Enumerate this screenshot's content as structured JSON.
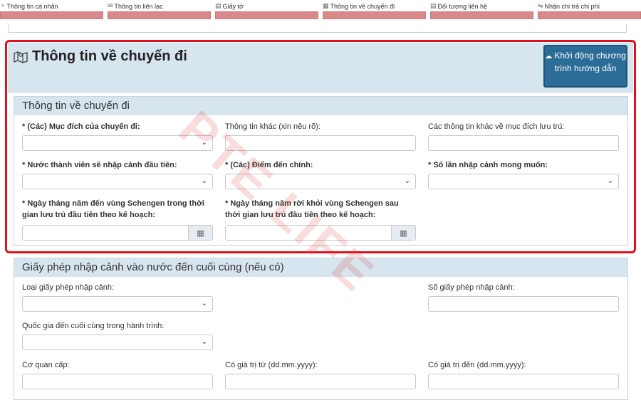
{
  "tabs": [
    {
      "label": "Thông tin cá nhân",
      "icon": "user-icon"
    },
    {
      "label": "Thông tin liên lạc",
      "icon": "contact-icon"
    },
    {
      "label": "Giấy tờ",
      "icon": "document-icon"
    },
    {
      "label": "Thông tin về chuyến đi",
      "icon": "map-icon"
    },
    {
      "label": "Đối tượng liên hệ",
      "icon": "people-icon"
    },
    {
      "label": "Nhận chi trả chi phí",
      "icon": "money-icon"
    }
  ],
  "trip": {
    "title": "Thông tin về chuyến đi",
    "guide_button": "Khởi động chương trình hướng dẫn"
  },
  "trip_panel": {
    "title": "Thông tin về chuyến đi",
    "fields": {
      "purpose": "* (Các) Mục đích của chuyến đi:",
      "other_info": "Thông tin khác (xin nêu rõ):",
      "other_stay": "Các thông tin khác về mục đích lưu trú:",
      "first_entry": "* Nước thành viên sẽ nhập cảnh đầu tiên:",
      "main_dest": "* (Các) Điểm đến chính:",
      "entries": "* Số lần nhập cảnh mong muốn:",
      "arrival_date": "* Ngày tháng năm đến vùng Schengen trong thời gian lưu trú đầu tiên theo kế hoạch:",
      "departure_date": "* Ngày tháng năm rời khỏi vùng Schengen sau thời gian lưu trú đầu tiên theo kế hoạch:"
    }
  },
  "permit_panel": {
    "title": "Giấy phép nhập cảnh vào nước đến cuối cùng (nếu có)",
    "fields": {
      "permit_type": "Loại giấy phép nhập cảnh:",
      "permit_no": "Số giấy phép nhập cảnh:",
      "final_country": "Quốc gia đến cuối cùng trong hành trình:",
      "issuer": "Cơ quan cấp:",
      "valid_from": "Có giá trị từ (dd.mm.yyyy):",
      "valid_to": "Có giá trị đến (dd.mm.yyyy):"
    }
  },
  "watermark": "PTE LIFE",
  "colors": {
    "accent": "#2c6d97",
    "highlight": "#e0101e",
    "header_bg": "#d7e5ef",
    "tab_bar": "#d88a8a"
  }
}
